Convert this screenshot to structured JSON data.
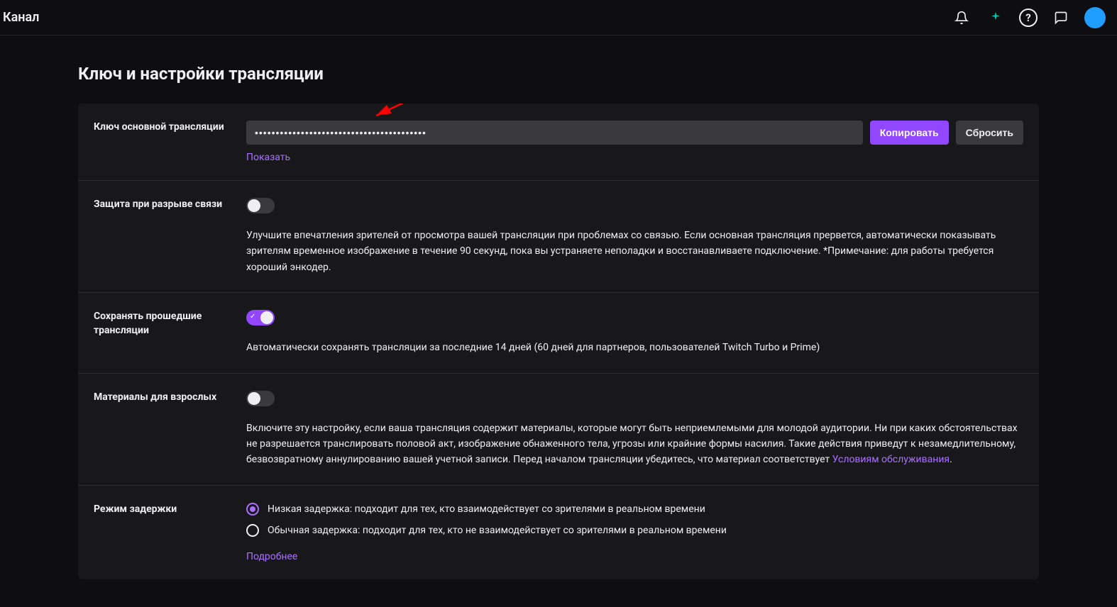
{
  "header": {
    "title": "Канал"
  },
  "page": {
    "title": "Ключ и настройки трансляции"
  },
  "streamKey": {
    "label": "Ключ основной трансляции",
    "value": "•••••••••••••••••••••••••••••••••••••••••",
    "copy": "Копировать",
    "reset": "Сбросить",
    "show": "Показать"
  },
  "disconnect": {
    "label": "Защита при разрыве связи",
    "desc": "Улучшите впечатления зрителей от просмотра вашей трансляции при проблемах со связью. Если основная трансляция прервется, автоматически показывать зрителям временное изображение в течение 90 секунд, пока вы устраняете неполадки и восстанавливаете подключение. *Примечание: для работы требуется хороший энкодер."
  },
  "vod": {
    "label": "Сохранять прошедшие трансляции",
    "desc": "Автоматически сохранять трансляции за последние 14 дней (60 дней для партнеров, пользователей Twitch Turbo и Prime)"
  },
  "mature": {
    "label": "Материалы для взрослых",
    "desc_pre": "Включите эту настройку, если ваша трансляция содержит материалы, которые могут быть неприемлемыми для молодой аудитории. Ни при каких обстоятельствах не разрешается транслировать половой акт, изображение обнаженного тела, угрозы или крайние формы насилия. Такие действия приведут к незамедлительному, безвозвратному аннулированию вашей учетной записи. Перед началом трансляции убедитесь, что материал соответствует ",
    "tos_link": "Условиям обслуживания",
    "desc_post": "."
  },
  "latency": {
    "label": "Режим задержки",
    "low": "Низкая задержка: подходит для тех, кто взаимодействует со зрителями в реальном времени",
    "normal": "Обычная задержка: подходит для тех, кто не взаимодействует со зрителями в реальном времени",
    "more": "Подробнее"
  }
}
